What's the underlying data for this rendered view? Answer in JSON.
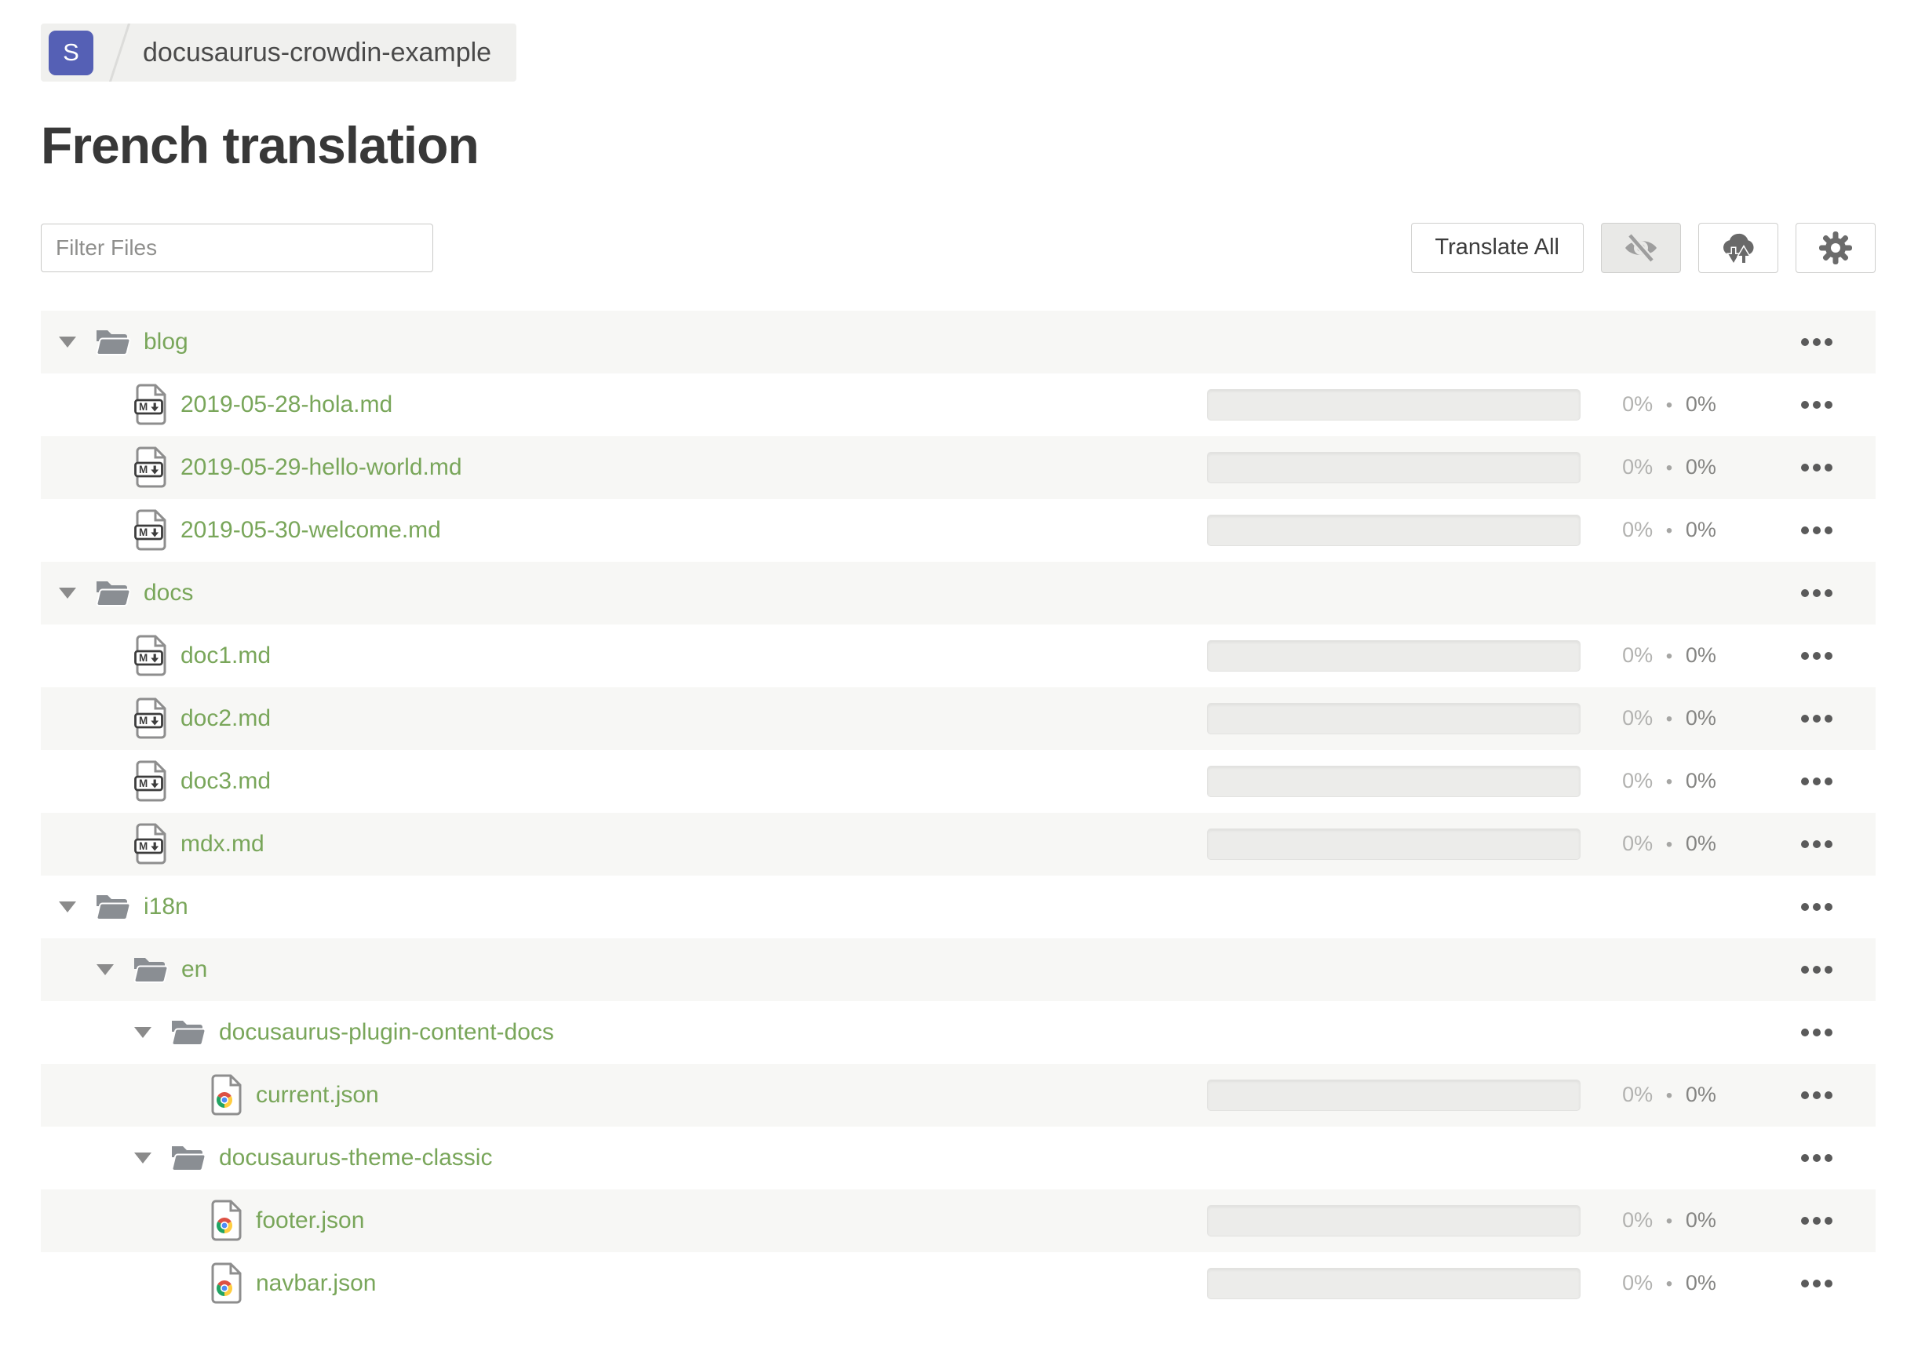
{
  "breadcrumb": {
    "project_initial": "S",
    "project_name": "docusaurus-crowdin-example"
  },
  "page_title": "French translation",
  "toolbar": {
    "filter_placeholder": "Filter Files",
    "translate_all_label": "Translate All",
    "icon_buttons": [
      {
        "name": "eye-off-icon",
        "meaning": "hide-completed-toggle",
        "active": true
      },
      {
        "name": "cloud-sync-icon",
        "meaning": "sync-files",
        "active": false
      },
      {
        "name": "gear-icon",
        "meaning": "settings",
        "active": false
      }
    ]
  },
  "progress_separator": "•",
  "icons": {
    "collapse": "caret-down-icon",
    "folder": "folder-icon",
    "markdown_file": "markdown-file-icon",
    "json_file": "json-file-icon",
    "row_menu": "ellipsis-icon"
  },
  "colors": {
    "accent_green": "#79a65a",
    "badge_indigo": "#5560b5",
    "row_stripe": "#f7f7f5",
    "progress_track": "#ececea"
  },
  "tree": [
    {
      "type": "folder",
      "name": "blog",
      "depth": 0,
      "expanded": true
    },
    {
      "type": "file",
      "kind": "markdown",
      "name": "2019-05-28-hola.md",
      "depth": 1,
      "translated": "0%",
      "approved": "0%"
    },
    {
      "type": "file",
      "kind": "markdown",
      "name": "2019-05-29-hello-world.md",
      "depth": 1,
      "translated": "0%",
      "approved": "0%"
    },
    {
      "type": "file",
      "kind": "markdown",
      "name": "2019-05-30-welcome.md",
      "depth": 1,
      "translated": "0%",
      "approved": "0%"
    },
    {
      "type": "folder",
      "name": "docs",
      "depth": 0,
      "expanded": true
    },
    {
      "type": "file",
      "kind": "markdown",
      "name": "doc1.md",
      "depth": 1,
      "translated": "0%",
      "approved": "0%"
    },
    {
      "type": "file",
      "kind": "markdown",
      "name": "doc2.md",
      "depth": 1,
      "translated": "0%",
      "approved": "0%"
    },
    {
      "type": "file",
      "kind": "markdown",
      "name": "doc3.md",
      "depth": 1,
      "translated": "0%",
      "approved": "0%"
    },
    {
      "type": "file",
      "kind": "markdown",
      "name": "mdx.md",
      "depth": 1,
      "translated": "0%",
      "approved": "0%"
    },
    {
      "type": "folder",
      "name": "i18n",
      "depth": 0,
      "expanded": true
    },
    {
      "type": "folder",
      "name": "en",
      "depth": 1,
      "expanded": true
    },
    {
      "type": "folder",
      "name": "docusaurus-plugin-content-docs",
      "depth": 2,
      "expanded": true
    },
    {
      "type": "file",
      "kind": "json",
      "name": "current.json",
      "depth": 3,
      "translated": "0%",
      "approved": "0%"
    },
    {
      "type": "folder",
      "name": "docusaurus-theme-classic",
      "depth": 2,
      "expanded": true
    },
    {
      "type": "file",
      "kind": "json",
      "name": "footer.json",
      "depth": 3,
      "translated": "0%",
      "approved": "0%"
    },
    {
      "type": "file",
      "kind": "json",
      "name": "navbar.json",
      "depth": 3,
      "translated": "0%",
      "approved": "0%"
    }
  ]
}
